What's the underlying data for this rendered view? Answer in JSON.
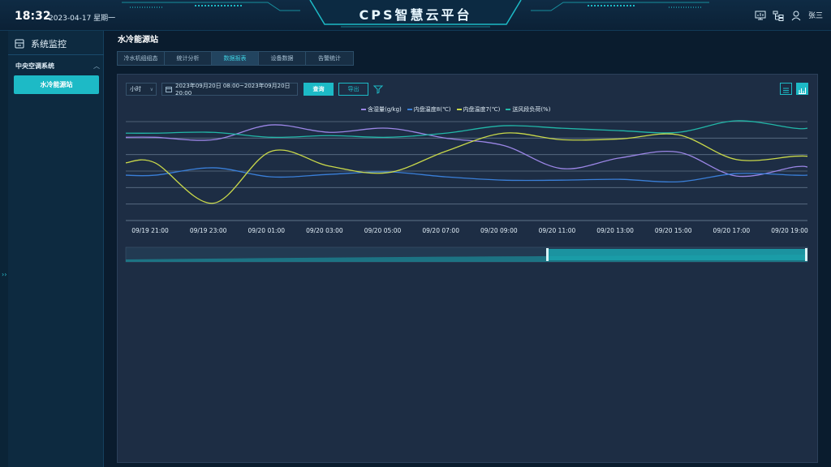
{
  "header": {
    "time": "18:32",
    "date": "2023-04-17 星期一",
    "title": "CPS智慧云平台",
    "user": "张三",
    "icons": [
      "monitor-icon",
      "org-chart-icon",
      "user-icon"
    ]
  },
  "sidebar": {
    "title": "系统监控",
    "group": "中央空调系统",
    "item": "水冷能源站",
    "collapse_handle": "››"
  },
  "main": {
    "page_title": "水冷能源站",
    "tabs": [
      {
        "label": "冷水机组组态"
      },
      {
        "label": "统计分析"
      },
      {
        "label": "数据报表",
        "active": true
      },
      {
        "label": "设备数据"
      },
      {
        "label": "告警统计"
      }
    ],
    "controls": {
      "interval": "小时",
      "range": "2023年09月20日 08:00~2023年09月20日 20:00",
      "query": "查询",
      "export": "导出"
    }
  },
  "colors": {
    "accent": "#1dbac6",
    "panel": "#1d2d44"
  },
  "chart_data": {
    "type": "line",
    "x": [
      "09/19 21:00",
      "09/19 23:00",
      "09/20 01:00",
      "09/20 03:00",
      "09/20 05:00",
      "09/20 07:00",
      "09/20 09:00",
      "09/20 11:00",
      "09/20 13:00",
      "09/20 15:00",
      "09/20 17:00",
      "09/20 19:00"
    ],
    "series": [
      {
        "name": "含湿量(g/kg)",
        "color": "#9b86e6",
        "values": [
          4.1,
          3.8,
          5.6,
          4.7,
          5.2,
          4.0,
          3.1,
          0.3,
          1.6,
          2.3,
          -0.6,
          0.5
        ]
      },
      {
        "name": "内盘温度8(℃)",
        "color": "#3a7fd8",
        "values": [
          -0.5,
          0.4,
          -0.7,
          -0.4,
          -0.1,
          -0.7,
          -1.1,
          -1.1,
          -1.0,
          -1.3,
          -0.3,
          -0.5
        ]
      },
      {
        "name": "内盘温度7(℃)",
        "color": "#c9d84a",
        "values": [
          1.0,
          -3.9,
          2.4,
          0.6,
          -0.2,
          2.4,
          4.6,
          3.8,
          3.9,
          4.4,
          1.4,
          1.8
        ]
      },
      {
        "name": "送风段负荷(%)",
        "color": "#22b7a8",
        "values": [
          4.6,
          4.7,
          4.1,
          4.3,
          4.1,
          4.6,
          5.5,
          5.2,
          4.9,
          4.7,
          6.1,
          5.2
        ]
      }
    ],
    "ylim": [
      -6,
      6
    ],
    "grid": true,
    "legend": "top-center"
  }
}
